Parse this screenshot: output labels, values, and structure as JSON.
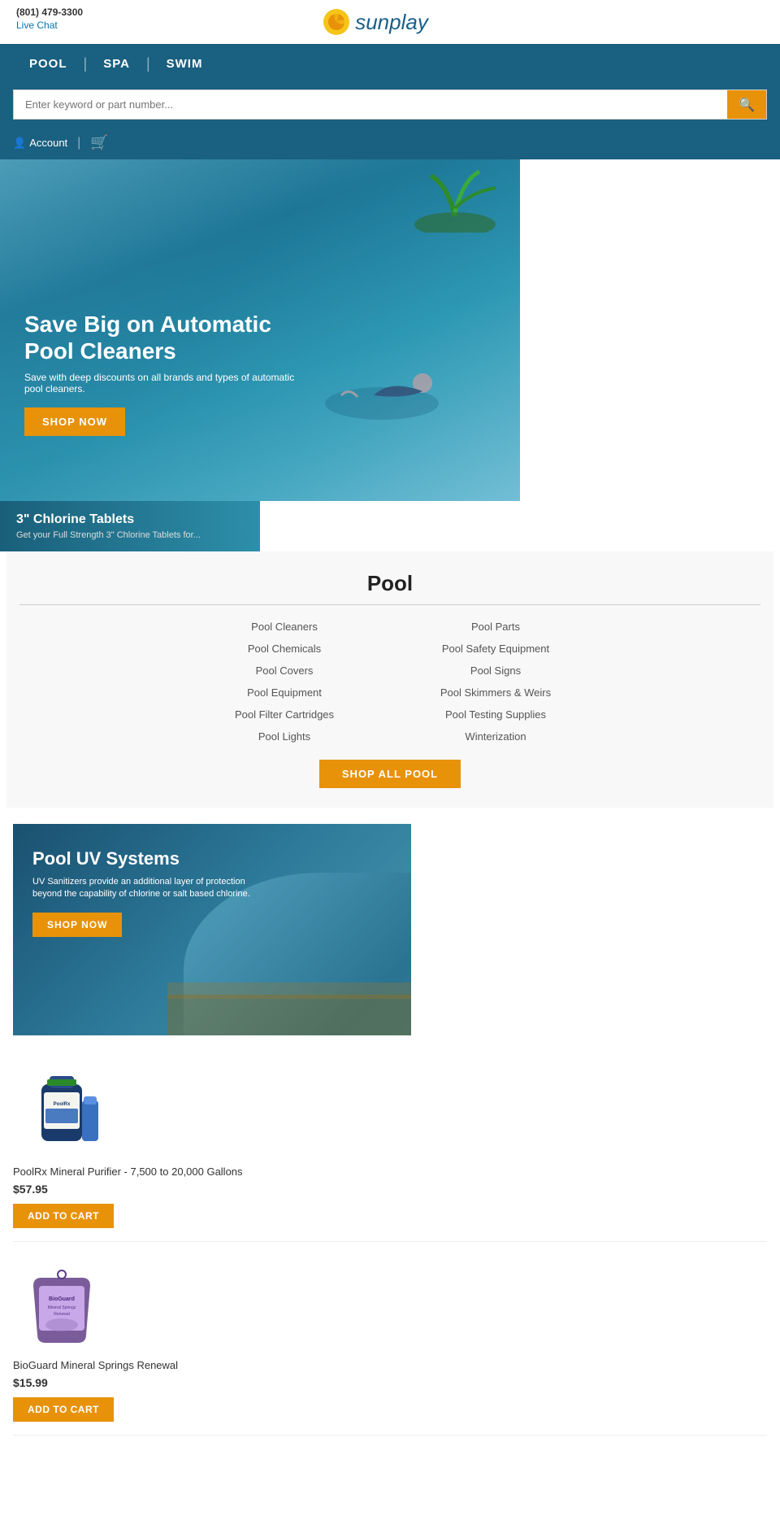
{
  "topbar": {
    "phone": "(801) 479-3300",
    "live_chat": "Live Chat"
  },
  "logo": {
    "brand": "sunplay"
  },
  "nav": {
    "items": [
      {
        "label": "POOL",
        "href": "#"
      },
      {
        "label": "SPA",
        "href": "#"
      },
      {
        "label": "SWIM",
        "href": "#"
      }
    ]
  },
  "search": {
    "placeholder": "Enter keyword or part number...",
    "button_label": "🔍"
  },
  "account": {
    "label": "Account",
    "cart_label": "🛒"
  },
  "hero": {
    "title": "Save Big on Automatic Pool Cleaners",
    "subtitle": "Save with deep discounts on all brands and types of automatic pool cleaners.",
    "button_label": "SHOP NOW"
  },
  "chlorine_banner": {
    "title": "3\" Chlorine Tablets",
    "subtitle": "Get your Full Strength 3\" Chlorine Tablets for..."
  },
  "pool_section": {
    "heading": "Pool",
    "links_col1": [
      "Pool Cleaners",
      "Pool Chemicals",
      "Pool Covers",
      "Pool Equipment",
      "Pool Filter Cartridges",
      "Pool Lights"
    ],
    "links_col2": [
      "Pool Parts",
      "Pool Safety Equipment",
      "Pool Signs",
      "Pool Skimmers & Weirs",
      "Pool Testing Supplies",
      "Winterization"
    ],
    "shop_button": "SHOP ALL POOL"
  },
  "uv_section": {
    "title": "Pool UV Systems",
    "subtitle": "UV Sanitizers provide an additional layer of protection beyond the capability of chlorine or salt based chlorine.",
    "button_label": "SHOP NOW"
  },
  "products": [
    {
      "name": "PoolRx Mineral Purifier - 7,500 to 20,000 Gallons",
      "price": "$57.95",
      "button_label": "ADD TO CART",
      "color1": "#1a3a6b",
      "color2": "#5a8fd0"
    },
    {
      "name": "BioGuard Mineral Springs Renewal",
      "price": "$15.99",
      "button_label": "ADD TO CART",
      "color1": "#7a5c9a",
      "color2": "#b090cc"
    }
  ]
}
